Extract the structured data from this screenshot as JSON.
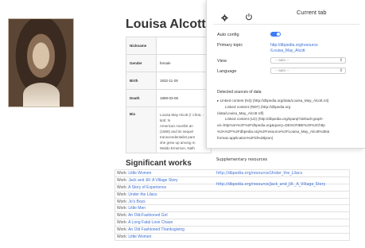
{
  "page": {
    "title": "Louisa Alcott",
    "info_rows": [
      {
        "key": "Nickname",
        "value": ""
      },
      {
        "key": "Gender",
        "value": "female"
      },
      {
        "key": "Birth",
        "value": "1832-11-29"
      },
      {
        "key": "Death",
        "value": "1888-03-06"
      }
    ],
    "bio": {
      "key": "Bio",
      "lines": [
        "Louisa May Alcott (/ˈɔːlkət, -kɒt/; N",
        "American novelist an",
        "(1868) and its sequel",
        "transcendentalist pare",
        "she grew up among m",
        "Waldo Emerson, Nath"
      ]
    },
    "section_title": "Significant works",
    "works": [
      {
        "label": "Work:",
        "title": "Little Women"
      },
      {
        "label": "Work:",
        "title": "Jack and Jill: A Village Story"
      },
      {
        "label": "Work:",
        "title": "A Story of Experience"
      },
      {
        "label": "Work:",
        "title": "Under the Lilacs"
      },
      {
        "label": "Work:",
        "title": "Jo's Boys"
      },
      {
        "label": "Work:",
        "title": "Little Men"
      },
      {
        "label": "Work:",
        "title": "An Old-Fashioned Girl"
      },
      {
        "label": "Work:",
        "title": "A Long Fatal Love Chase"
      },
      {
        "label": "Work:",
        "title": "An Old Fashioned Thanksgiving"
      },
      {
        "label": "Work:",
        "title": "Little Women"
      }
    ]
  },
  "popup": {
    "title": "Current tab",
    "auto_config_label": "Auto config",
    "auto_config_on": true,
    "primary_topic_label": "Primary topic",
    "primary_topic_link_lines": [
      "http://dbpedia.org/resource",
      "/Louisa_May_Alcott"
    ],
    "view_label": "View",
    "view_value": "-- auto --",
    "language_label": "Language",
    "language_value": "-- auto --",
    "detected_title": "Detected sources of data",
    "detected_lines": [
      "▸ Linked content (N3) (http://dbpedia.org/data/Louisa_May_Alcott.n3)",
      "Linked content (RDF) (http://dbpedia.org",
      "/data/Louisa_May_Alcott.rdf)",
      "Linked content (LD) (http://dbpedia.org/sparql?default-graph-",
      "uri=http%3A%2F%2Fdbpedia.org&query=DESCRIBE%20%3Chttp",
      "%3A%2F%2Fdbpedia.org%2Fresource%2FLouisa_May_Alcott%3E&",
      "format=application%2Fld%2Bjson)"
    ],
    "supp_title": "Supplementary resources",
    "supp_links": [
      "http://dbpedia.org/resource/Under_the_Lilacs",
      "http://dbpedia.org/resource/Jack_and_Jill:_A_Village_Story"
    ],
    "colors": {
      "accent": "#3b7cf5",
      "link": "#3b6fd4"
    }
  }
}
